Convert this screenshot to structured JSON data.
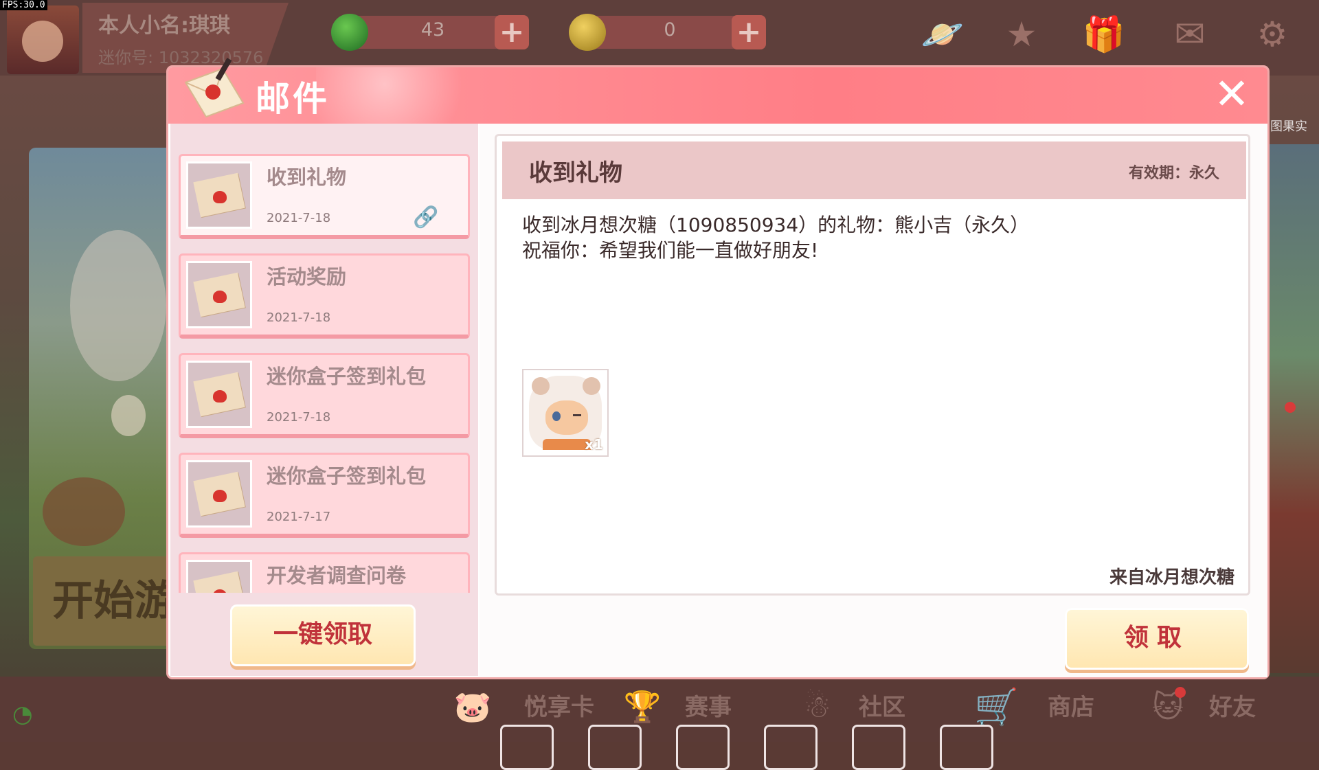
{
  "fps": "FPS:30.0",
  "player": {
    "name": "本人小名:琪琪",
    "id": "迷你号: 1032320576"
  },
  "currencies": [
    {
      "icon": "green-coin-icon",
      "value": "43"
    },
    {
      "icon": "gold-coin-icon",
      "value": "0"
    }
  ],
  "top_icons": [
    "planet-icon",
    "star-icon",
    "gift-icon",
    "mail-icon",
    "gear-icon"
  ],
  "background": {
    "start_game": "开始游",
    "right_label": "图果实"
  },
  "dialog": {
    "title": "邮件",
    "close": "✕",
    "claim_all": "一键领取",
    "claim": "领取"
  },
  "mail_list": [
    {
      "title": "收到礼物",
      "date": "2021-7-18",
      "selected": true,
      "has_attachment": true
    },
    {
      "title": "活动奖励",
      "date": "2021-7-18",
      "selected": false,
      "has_attachment": false
    },
    {
      "title": "迷你盒子签到礼包",
      "date": "2021-7-18",
      "selected": false,
      "has_attachment": false
    },
    {
      "title": "迷你盒子签到礼包",
      "date": "2021-7-17",
      "selected": false,
      "has_attachment": false
    },
    {
      "title": "开发者调查问卷",
      "date": "",
      "selected": false,
      "has_attachment": false
    }
  ],
  "detail": {
    "title": "收到礼物",
    "validity": "有效期：永久",
    "line1": "收到冰月想次糖（1090850934）的礼物：熊小吉（永久）",
    "line2": "祝福你：希望我们能一直做好朋友!",
    "reward_count": "x1",
    "sender": "来自冰月想次糖"
  },
  "bottom_nav": [
    {
      "icon": "pig-icon",
      "label": "悦享卡"
    },
    {
      "icon": "trophy-icon",
      "label": "赛事"
    },
    {
      "icon": "community-icon",
      "label": "社区"
    },
    {
      "icon": "cart-icon",
      "label": "商店"
    },
    {
      "icon": "friend-icon",
      "label": "好友"
    }
  ],
  "colors": {
    "header": "#ff7e86",
    "accent_text": "#c0323a",
    "list_panel": "#f4dde2"
  }
}
